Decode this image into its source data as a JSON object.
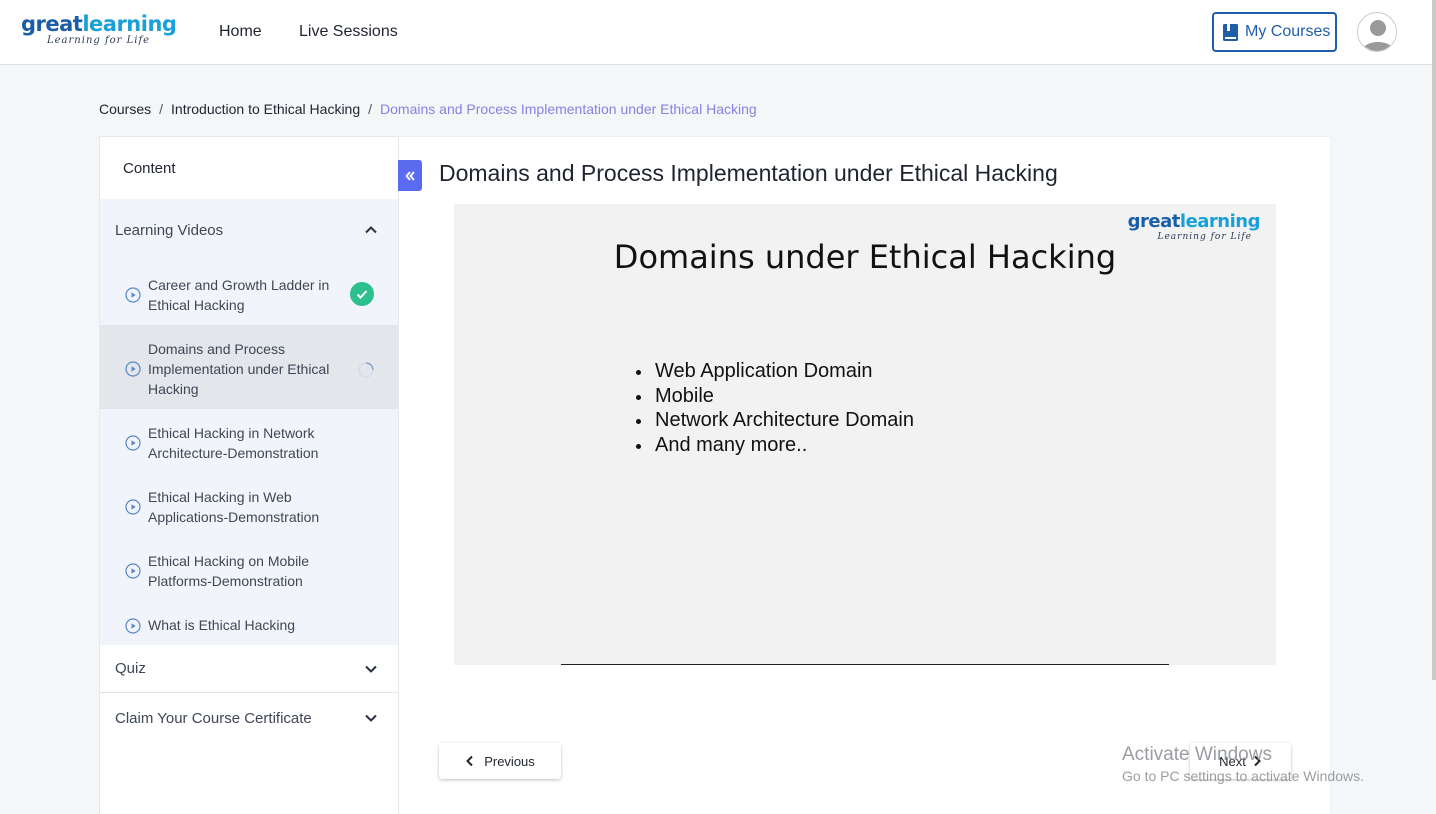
{
  "header": {
    "logo_main_a": "great",
    "logo_main_b": "learning",
    "logo_tagline": "Learning for Life",
    "nav": [
      "Home",
      "Live Sessions"
    ],
    "my_courses_label": "My Courses",
    "accent": "#1e5fa8"
  },
  "breadcrumb": {
    "items": [
      "Courses",
      "Introduction to Ethical Hacking",
      "Domains and Process Implementation under Ethical Hacking"
    ],
    "separator": "/"
  },
  "sidebar": {
    "content_label": "Content",
    "sections": [
      {
        "label": "Learning Videos",
        "expanded": true,
        "items": [
          {
            "title": "Career and Growth Ladder in Ethical Hacking",
            "status": "completed"
          },
          {
            "title": "Domains and Process Implementation under Ethical Hacking",
            "status": "in-progress",
            "active": true
          },
          {
            "title": "Ethical Hacking in Network Architecture-Demonstration",
            "status": "none"
          },
          {
            "title": "Ethical Hacking in Web Applications-Demonstration",
            "status": "none"
          },
          {
            "title": "Ethical Hacking on Mobile Platforms-Demonstration",
            "status": "none"
          },
          {
            "title": "What is Ethical Hacking",
            "status": "none"
          }
        ]
      },
      {
        "label": "Quiz",
        "expanded": false
      },
      {
        "label": "Claim Your Course Certificate",
        "expanded": false
      }
    ]
  },
  "main": {
    "title": "Domains and Process Implementation under Ethical Hacking",
    "collapse_icon": "double-chevron-left-icon",
    "slide": {
      "logo_main_a": "great",
      "logo_main_b": "learning",
      "logo_tagline": "Learning for Life",
      "heading": "Domains under Ethical Hacking",
      "bullets": [
        "Web Application Domain",
        "Mobile",
        "Network Architecture Domain",
        "And many more.."
      ]
    },
    "prev_label": "Previous",
    "next_label": "Next"
  },
  "watermark": {
    "line1": "Activate Windows",
    "line2": "Go to PC settings to activate Windows."
  }
}
